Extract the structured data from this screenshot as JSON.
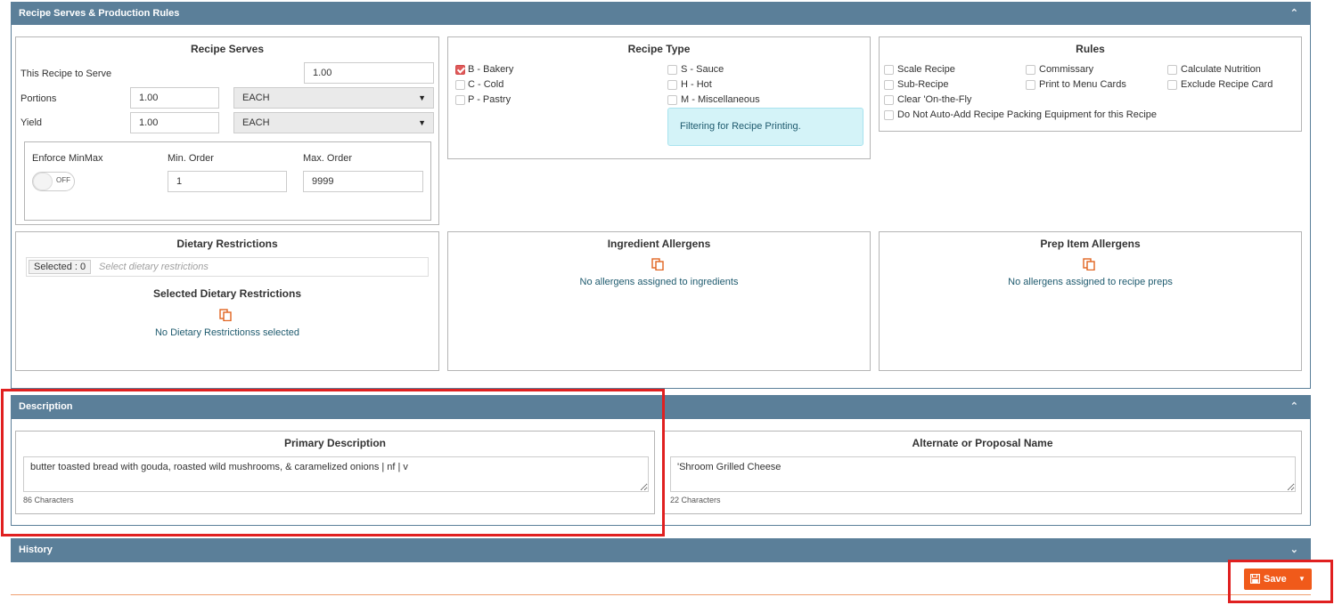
{
  "serves_panel": {
    "title": "Recipe Serves & Production Rules",
    "recipe_serves": {
      "title": "Recipe Serves",
      "serve_label": "This Recipe to Serve",
      "serve_value": "1.00",
      "portions_label": "Portions",
      "portions_value": "1.00",
      "portions_unit": "EACH",
      "yield_label": "Yield",
      "yield_value": "1.00",
      "yield_unit": "EACH",
      "enforce_label": "Enforce MinMax",
      "toggle_text": "OFF",
      "min_label": "Min. Order",
      "min_value": "1",
      "max_label": "Max. Order",
      "max_value": "9999"
    },
    "recipe_type": {
      "title": "Recipe Type",
      "options": [
        {
          "label": "B - Bakery",
          "checked": true
        },
        {
          "label": "C - Cold",
          "checked": false
        },
        {
          "label": "P - Pastry",
          "checked": false
        },
        {
          "label": "S - Sauce",
          "checked": false
        },
        {
          "label": "H - Hot",
          "checked": false
        },
        {
          "label": "M - Miscellaneous",
          "checked": false
        }
      ],
      "info": "Filtering for Recipe Printing."
    },
    "rules": {
      "title": "Rules",
      "options": [
        "Scale Recipe",
        "Commissary",
        "Calculate Nutrition",
        "Sub-Recipe",
        "Print to Menu Cards",
        "Exclude Recipe Card",
        "Clear 'On-the-Fly",
        "Do Not Auto-Add Recipe Packing Equipment for this Recipe"
      ]
    },
    "dietary": {
      "title": "Dietary Restrictions",
      "selected_badge": "Selected : 0",
      "placeholder": "Select dietary restrictions",
      "selected_title": "Selected Dietary Restrictions",
      "empty": "No Dietary Restrictionss selected"
    },
    "ingredient_allergens": {
      "title": "Ingredient Allergens",
      "empty": "No allergens assigned to ingredients"
    },
    "prep_allergens": {
      "title": "Prep Item Allergens",
      "empty": "No allergens assigned to recipe preps"
    }
  },
  "description_panel": {
    "title": "Description",
    "primary_title": "Primary Description",
    "primary_text": "butter toasted bread with gouda, roasted wild mushrooms, & caramelized onions | nf | v",
    "primary_count": "86 Characters",
    "alternate_title": "Alternate or Proposal Name",
    "alternate_text": "'Shroom Grilled Cheese",
    "alternate_count": "22 Characters"
  },
  "history_panel": {
    "title": "History"
  },
  "save_button": {
    "label": "Save"
  },
  "colors": {
    "panel_header": "#5b7f99",
    "accent_orange": "#f05a1a",
    "highlight_red": "#e02020",
    "info_bg": "#d4f3f8"
  }
}
